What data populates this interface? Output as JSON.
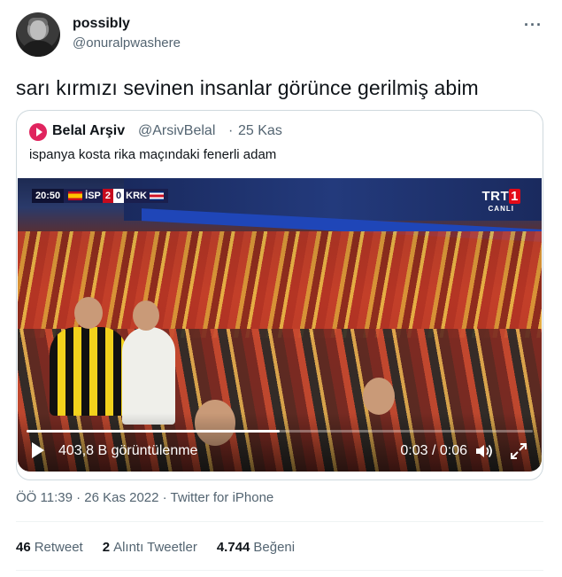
{
  "author": {
    "display_name": "possibly",
    "handle": "@onuralpwashere",
    "more_label": "···"
  },
  "tweet": {
    "text": "sarı kırmızı sevinen insanlar görünce gerilmiş abim"
  },
  "quoted_tweet": {
    "display_name": "Belal Arşiv",
    "handle": "@ArsivBelal",
    "separator": "·",
    "date": "25 Kas",
    "text": "ispanya kosta rika maçındaki fenerli adam",
    "video": {
      "scoreboard": {
        "time": "20:50",
        "home": "İSP",
        "home_score": "2",
        "away_score": "0",
        "away": "KRK"
      },
      "channel": {
        "name_prefix": "TRT",
        "name_number": "1",
        "live_label": "CANLI"
      },
      "views_label": "403,8 B görüntülenme",
      "time_label": "0:03 / 0:06",
      "progress_fraction": 0.5
    }
  },
  "meta": {
    "text": "ÖÖ 11:39 · 26 Kas 2022 · Twitter for iPhone"
  },
  "stats": {
    "retweets_count": "46",
    "retweets_label": "Retweet",
    "quotes_count": "2",
    "quotes_label": "Alıntı Tweetler",
    "likes_count": "4.744",
    "likes_label": "Beğeni"
  },
  "icons": {
    "more": "more-horizontal-icon",
    "play": "play-icon",
    "volume": "volume-icon",
    "fullscreen": "fullscreen-icon"
  },
  "colors": {
    "text_primary": "#0f1419",
    "text_secondary": "#536471",
    "border": "#cfd9de",
    "quoted_avatar": "#e0245e"
  }
}
